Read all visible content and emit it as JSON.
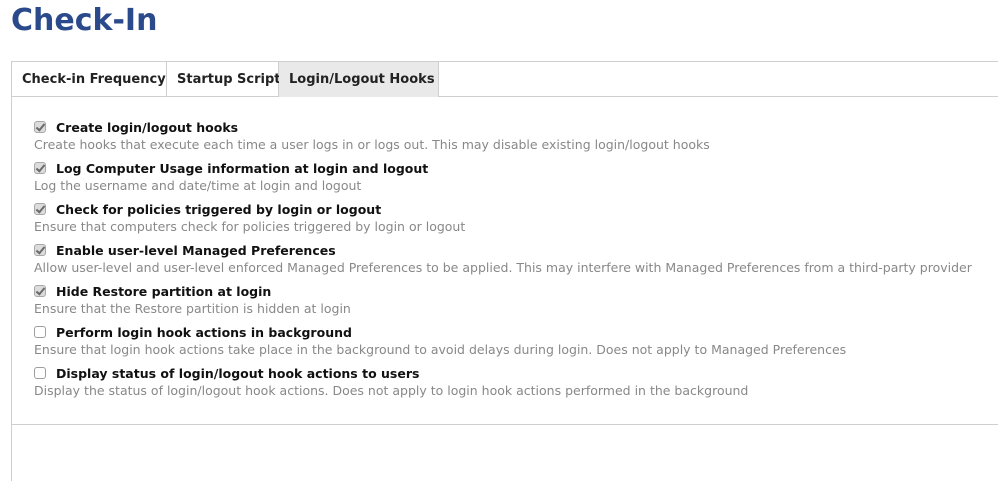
{
  "page": {
    "title": "Check-In"
  },
  "tabs": [
    {
      "label": "Check-in Frequency",
      "active": false
    },
    {
      "label": "Startup Script",
      "active": false
    },
    {
      "label": "Login/Logout Hooks",
      "active": true
    }
  ],
  "options": [
    {
      "label": "Create login/logout hooks",
      "description": "Create hooks that execute each time a user logs in or logs out. This may disable existing login/logout hooks",
      "checked": true
    },
    {
      "label": "Log Computer Usage information at login and logout",
      "description": "Log the username and date/time at login and logout",
      "checked": true
    },
    {
      "label": "Check for policies triggered by login or logout",
      "description": "Ensure that computers check for policies triggered by login or logout",
      "checked": true
    },
    {
      "label": "Enable user-level Managed Preferences",
      "description": "Allow user-level and user-level enforced Managed Preferences to be applied. This may interfere with Managed Preferences from a third-party provider",
      "checked": true
    },
    {
      "label": "Hide Restore partition at login",
      "description": "Ensure that the Restore partition is hidden at login",
      "checked": true
    },
    {
      "label": "Perform login hook actions in background",
      "description": "Ensure that login hook actions take place in the background to avoid delays during login. Does not apply to Managed Preferences",
      "checked": false
    },
    {
      "label": "Display status of login/logout hook actions to users",
      "description": "Display the status of login/logout hook actions. Does not apply to login hook actions performed in the background",
      "checked": false
    }
  ],
  "colors": {
    "title": "#2b4a8c",
    "description": "#888888",
    "border": "#cfcfcf",
    "active_tab": "#e9e9e9"
  }
}
